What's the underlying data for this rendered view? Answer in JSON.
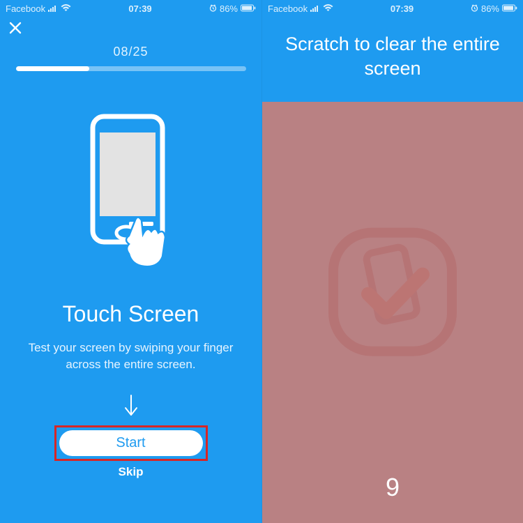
{
  "status": {
    "carrier": "Facebook",
    "time": "07:39",
    "battery": "86%"
  },
  "left": {
    "progress_label": "08/25",
    "progress_pct": 32,
    "title": "Touch Screen",
    "desc": "Test your screen by swiping your finger across the entire screen.",
    "start_label": "Start",
    "skip_label": "Skip"
  },
  "right": {
    "title": "Scratch to clear the entire screen",
    "countdown": "9"
  }
}
